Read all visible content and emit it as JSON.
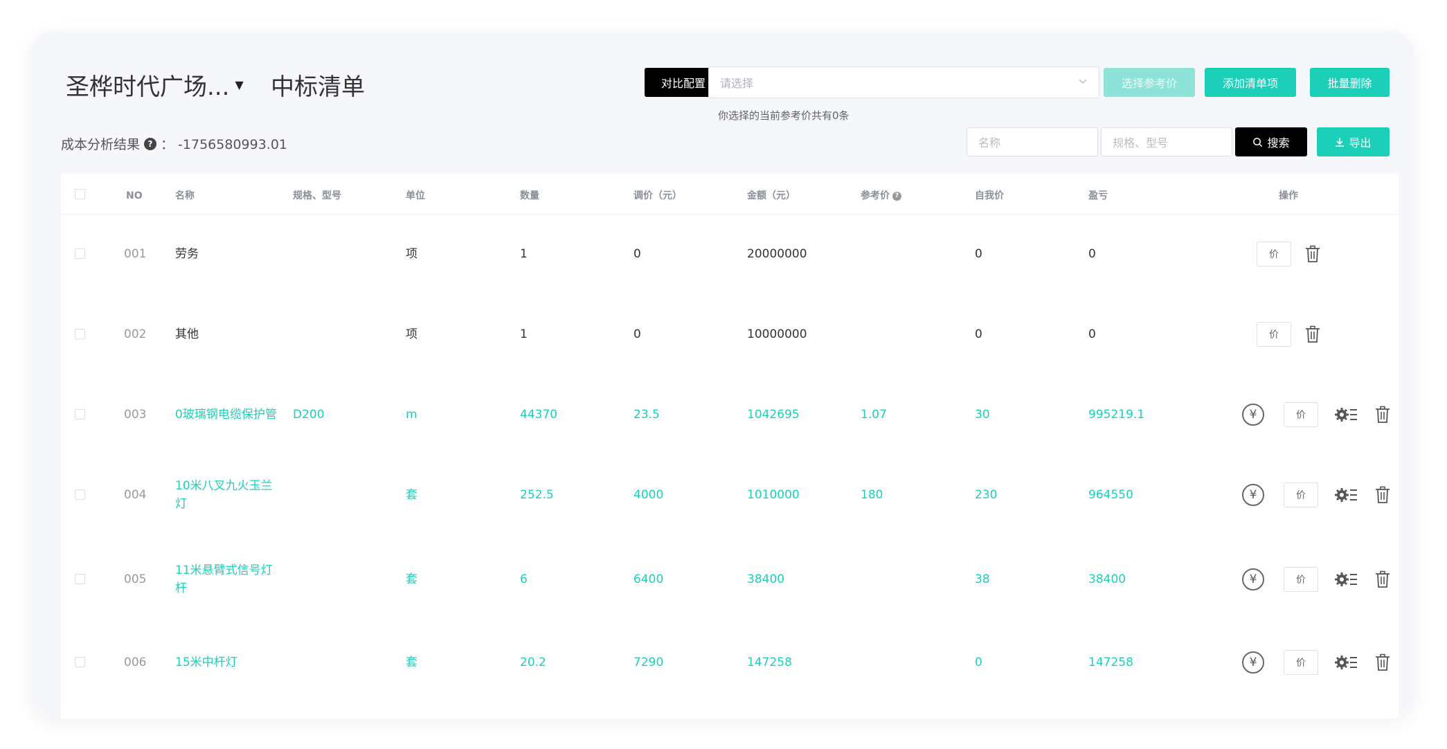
{
  "header": {
    "project": "圣桦时代广场...",
    "title": "中标清单"
  },
  "toolbar": {
    "compare": "对比配置",
    "select_placeholder": "请选择",
    "choose_ref": "选择参考价",
    "add_item": "添加清单项",
    "batch_delete": "批量删除",
    "hint": "你选择的当前参考价共有0条",
    "name_placeholder": "名称",
    "spec_placeholder": "规格、型号",
    "search": "搜索",
    "export": "导出"
  },
  "cost": {
    "label": "成本分析结果",
    "help": "?",
    "value": "：  -1756580993.01"
  },
  "columns": {
    "no": "NO",
    "name": "名称",
    "spec": "规格、型号",
    "unit": "单位",
    "qty": "数量",
    "adj": "调价（元）",
    "amount": "金额（元）",
    "ref": "参考价",
    "self": "自我价",
    "profit": "盈亏",
    "ops": "操作"
  },
  "price_button": "价",
  "yen_symbol": "¥",
  "rows": [
    {
      "no": "001",
      "name": "劳务",
      "name2": "",
      "spec": "",
      "unit": "项",
      "qty": "1",
      "adj": "0",
      "amount": "20000000",
      "ref": "",
      "self": "0",
      "profit": "0",
      "style": "dark"
    },
    {
      "no": "002",
      "name": "其他",
      "name2": "",
      "spec": "",
      "unit": "项",
      "qty": "1",
      "adj": "0",
      "amount": "10000000",
      "ref": "",
      "self": "0",
      "profit": "0",
      "style": "dark"
    },
    {
      "no": "003",
      "name": "0玻璃钢电缆保护管",
      "name2": "",
      "spec": "D200",
      "unit": "m",
      "qty": "44370",
      "adj": "23.5",
      "amount": "1042695",
      "ref": "1.07",
      "self": "30",
      "profit": "995219.1",
      "style": "teal"
    },
    {
      "no": "004",
      "name": "10米八叉九火玉兰",
      "name2": "灯",
      "spec": "",
      "unit": "套",
      "qty": "252.5",
      "adj": "4000",
      "amount": "1010000",
      "ref": "180",
      "self": "230",
      "profit": "964550",
      "style": "teal"
    },
    {
      "no": "005",
      "name": "11米悬臂式信号灯",
      "name2": "杆",
      "spec": "",
      "unit": "套",
      "qty": "6",
      "adj": "6400",
      "amount": "38400",
      "ref": "",
      "self": "38",
      "profit": "38400",
      "style": "teal"
    },
    {
      "no": "006",
      "name": "15米中杆灯",
      "name2": "",
      "spec": "",
      "unit": "套",
      "qty": "20.2",
      "adj": "7290",
      "amount": "147258",
      "ref": "",
      "self": "0",
      "profit": "147258",
      "style": "teal"
    }
  ]
}
